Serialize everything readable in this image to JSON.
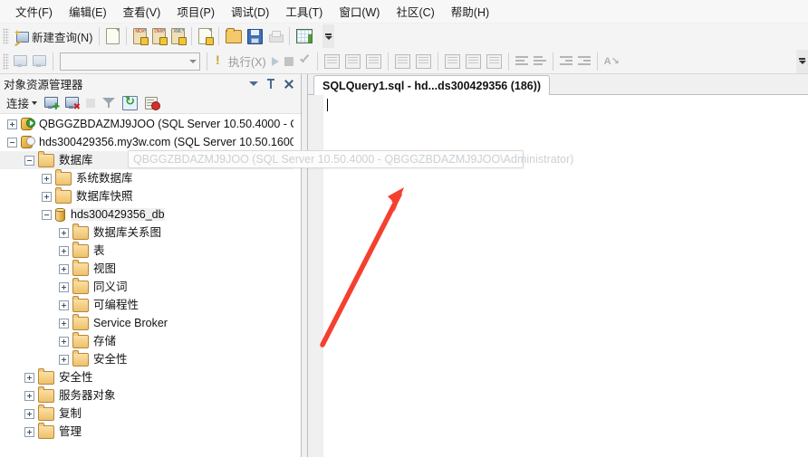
{
  "menubar": {
    "items": [
      {
        "label": "文件(F)",
        "name": "menu-file"
      },
      {
        "label": "编辑(E)",
        "name": "menu-edit"
      },
      {
        "label": "查看(V)",
        "name": "menu-view"
      },
      {
        "label": "项目(P)",
        "name": "menu-project"
      },
      {
        "label": "调试(D)",
        "name": "menu-debug"
      },
      {
        "label": "工具(T)",
        "name": "menu-tools"
      },
      {
        "label": "窗口(W)",
        "name": "menu-window"
      },
      {
        "label": "社区(C)",
        "name": "menu-community"
      },
      {
        "label": "帮助(H)",
        "name": "menu-help"
      }
    ]
  },
  "toolbar_main": {
    "new_query_label": "新建查询(N)",
    "icons": [
      "new-query-icon",
      "database-engine-query-icon",
      "analysis-mdx-query-icon",
      "analysis-dmx-query-icon",
      "analysis-xmla-query-icon",
      "new-project-query-icon",
      "open-file-icon",
      "save-icon",
      "print-icon",
      "activity-monitor-icon",
      "toolbar-overflow-icon"
    ]
  },
  "toolbar_editor": {
    "combo_value": "",
    "execute_label": "执行(X)",
    "icons": [
      "connect-icon",
      "disconnect-icon",
      "available-databases-combo",
      "parse-icon",
      "execute-icon",
      "debug-icon",
      "stop-icon",
      "parse-check-icon",
      "display-estimated-plan-icon",
      "query-options-icon",
      "include-actual-plan-icon",
      "include-client-statistics-icon",
      "results-to-text-icon",
      "results-to-grid-icon",
      "results-to-file-icon",
      "comment-icon",
      "uncomment-icon",
      "decrease-indent-icon",
      "increase-indent-icon",
      "sort-icon",
      "toolbar-overflow-icon"
    ]
  },
  "object_explorer": {
    "title": "对象资源管理器",
    "connect_label": "连接",
    "toolbar_icons": [
      "connect-object-explorer-icon",
      "disconnect-object-explorer-icon",
      "stop-icon",
      "filter-icon",
      "refresh-icon",
      "script-error-icon"
    ],
    "header_buttons": [
      "window-position-dropdown-icon",
      "auto-hide-pin-icon",
      "close-panel-icon"
    ],
    "tree": [
      {
        "label": "QBGGZBDAZMJ9JOO (SQL Server 10.50.4000 - Q",
        "indent": 0,
        "expander": "plus",
        "icon": "server-stopped-icon",
        "name": "tree-node-server-qbggzbdazmj9joo"
      },
      {
        "label": "hds300429356.my3w.com (SQL Server 10.50.1600",
        "indent": 0,
        "expander": "minus",
        "icon": "server-running-icon",
        "name": "tree-node-server-hds300429356"
      },
      {
        "label": "数据库",
        "indent": 1,
        "expander": "minus",
        "icon": "folder-icon",
        "name": "tree-node-databases"
      },
      {
        "label": "系统数据库",
        "indent": 2,
        "expander": "plus",
        "icon": "folder-icon",
        "name": "tree-node-system-databases"
      },
      {
        "label": "数据库快照",
        "indent": 2,
        "expander": "plus",
        "icon": "folder-icon",
        "name": "tree-node-database-snapshots"
      },
      {
        "label": "hds300429356_db",
        "indent": 2,
        "expander": "minus",
        "icon": "database-icon",
        "name": "tree-node-database-hds300429356-db"
      },
      {
        "label": "数据库关系图",
        "indent": 3,
        "expander": "plus",
        "icon": "folder-icon",
        "name": "tree-node-database-diagrams"
      },
      {
        "label": "表",
        "indent": 3,
        "expander": "plus",
        "icon": "folder-icon",
        "name": "tree-node-tables"
      },
      {
        "label": "视图",
        "indent": 3,
        "expander": "plus",
        "icon": "folder-icon",
        "name": "tree-node-views"
      },
      {
        "label": "同义词",
        "indent": 3,
        "expander": "plus",
        "icon": "folder-icon",
        "name": "tree-node-synonyms"
      },
      {
        "label": "可编程性",
        "indent": 3,
        "expander": "plus",
        "icon": "folder-icon",
        "name": "tree-node-programmability"
      },
      {
        "label": "Service Broker",
        "indent": 3,
        "expander": "plus",
        "icon": "folder-icon",
        "name": "tree-node-service-broker"
      },
      {
        "label": "存储",
        "indent": 3,
        "expander": "plus",
        "icon": "folder-icon",
        "name": "tree-node-storage"
      },
      {
        "label": "安全性",
        "indent": 3,
        "expander": "plus",
        "icon": "folder-icon",
        "name": "tree-node-database-security"
      },
      {
        "label": "安全性",
        "indent": 1,
        "expander": "plus",
        "icon": "folder-icon",
        "name": "tree-node-server-security"
      },
      {
        "label": "服务器对象",
        "indent": 1,
        "expander": "plus",
        "icon": "folder-icon",
        "name": "tree-node-server-objects"
      },
      {
        "label": "复制",
        "indent": 1,
        "expander": "plus",
        "icon": "folder-icon",
        "name": "tree-node-replication"
      },
      {
        "label": "管理",
        "indent": 1,
        "expander": "plus",
        "icon": "folder-icon",
        "name": "tree-node-management"
      }
    ]
  },
  "tooltip": {
    "text": "QBGGZBDAZMJ9JOO (SQL Server 10.50.4000 - QBGGZBDAZMJ9JOO\\Administrator)"
  },
  "document": {
    "tab_label": "SQLQuery1.sql - hd...ds300429356 (186))",
    "editor_text": ""
  },
  "annotation": {
    "arrow_color": "#f5402e",
    "name": "red-arrow-annotation"
  },
  "colors": {
    "chrome": "#f4f4f4",
    "menu_bg": "#f7f7f7",
    "panel_border": "#b9bfc6",
    "tooltip_text": "#c9cfd4",
    "accent_red": "#f5402e"
  }
}
